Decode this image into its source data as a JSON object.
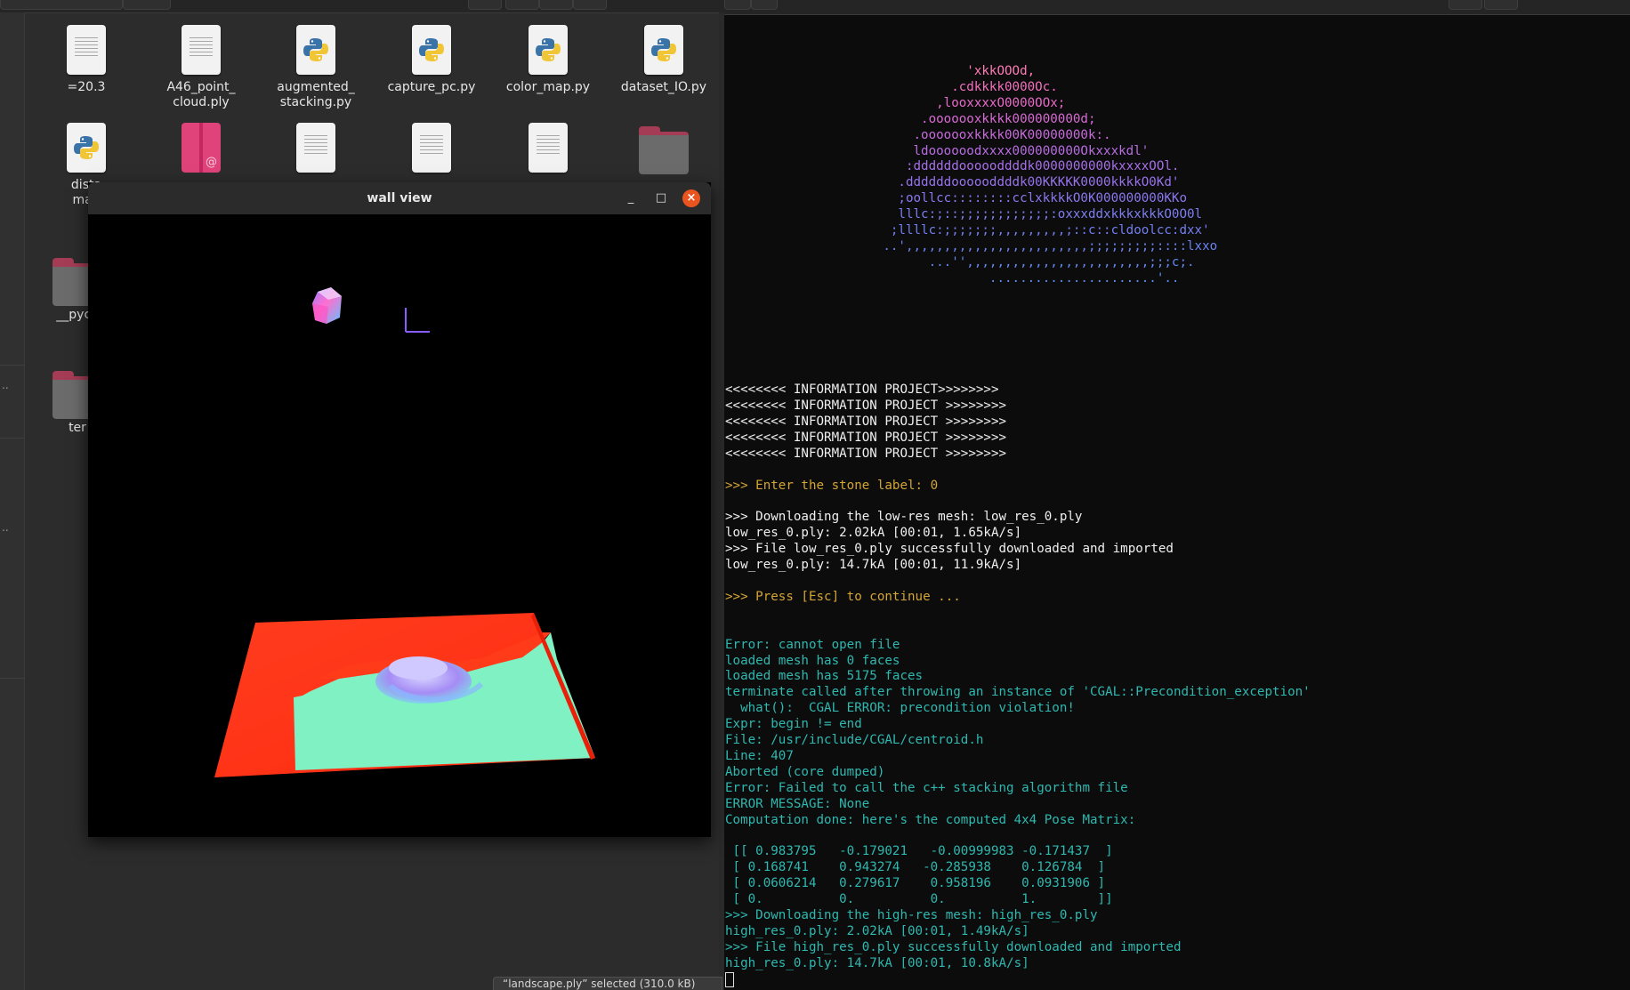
{
  "file_manager": {
    "items": [
      {
        "label": "=20.3",
        "icon": "text-file-icon"
      },
      {
        "label": "A46_point_\ncloud.ply",
        "icon": "text-file-icon"
      },
      {
        "label": "augmented_\nstacking.py",
        "icon": "python-file-icon"
      },
      {
        "label": "capture_pc.py",
        "icon": "python-file-icon"
      },
      {
        "label": "color_map.py",
        "icon": "python-file-icon"
      },
      {
        "label": "dataset_IO.py",
        "icon": "python-file-icon"
      },
      {
        "label": "dista\nmap",
        "icon": "python-file-icon"
      },
      {
        "label": "__pyca",
        "icon": "folder-icon"
      },
      {
        "label": "ter",
        "icon": "folder-icon"
      }
    ],
    "status": "“landscape.ply” selected  (310.0 kB)"
  },
  "viewer": {
    "title": "wall view",
    "minimize": "_",
    "maximize": "□",
    "close": "×"
  },
  "terminal": {
    "info_lines": [
      "<<<<<<<< INFORMATION PROJECT>>>>>>>>",
      "<<<<<<<< INFORMATION PROJECT >>>>>>>>",
      "<<<<<<<< INFORMATION PROJECT >>>>>>>>",
      "<<<<<<<< INFORMATION PROJECT >>>>>>>>",
      "<<<<<<<< INFORMATION PROJECT >>>>>>>>"
    ],
    "prompt_label": ">>> Enter the stone label: 0",
    "download_lines": [
      ">>> Downloading the low-res mesh: low_res_0.ply",
      "low_res_0.ply: 2.02kA [00:01, 1.65kA/s]",
      ">>> File low_res_0.ply successfully downloaded and imported",
      "low_res_0.ply: 14.7kA [00:01, 11.9kA/s]"
    ],
    "press_esc": ">>> Press [Esc] to continue ...",
    "error_lines": [
      "Error: cannot open file",
      "loaded mesh has 0 faces",
      "loaded mesh has 5175 faces",
      "terminate called after throwing an instance of 'CGAL::Precondition_exception'",
      "  what():  CGAL ERROR: precondition violation!",
      "Expr: begin != end",
      "File: /usr/include/CGAL/centroid.h",
      "Line: 407",
      "Aborted (core dumped)",
      "Error: Failed to call the c++ stacking algorithm file",
      "ERROR MESSAGE: None",
      "Computation done: here's the computed 4x4 Pose Matrix:"
    ],
    "matrix_lines": [
      " [[ 0.983795   -0.179021   -0.00999983 -0.171437  ]",
      " [ 0.168741    0.943274   -0.285938    0.126784  ]",
      " [ 0.0606214   0.279617    0.958196    0.0931906 ]",
      " [ 0.          0.          0.          1.        ]]"
    ],
    "final_lines": [
      ">>> Downloading the high-res mesh: high_res_0.ply",
      "high_res_0.ply: 2.02kA [00:01, 1.49kA/s]",
      ">>> File high_res_0.ply successfully downloaded and imported",
      "high_res_0.ply: 14.7kA [00:01, 10.8kA/s]"
    ],
    "ascii_art": [
      "                   'xkkOOOd,",
      "                 .cdkkkk0000Oc.",
      "               ,looxxxxO0000OOx;",
      "             .ooooooxkkkk000000000d;",
      "            .ooooooxkkkk00K00000000k:.",
      "            ldoooooodxxxx000000000Okxxxkdl'",
      "           :ddddddoooooddddk0000000000kxxxxOOl.",
      "          .ddddddoooooddddk00KKKKK0000kkkkO0Kd'",
      "          ;oollcc::::::::cclxkkkkO0K000000000KKo",
      "          lllc:;::;;;;;;;;;;;;:oxxxddxkkkxkkkO0O0l",
      "         ;llllc:;;;;;;;,,,,,,,,,;::c::cldoolcc:dxx'",
      "        ..',,,,,,,,,,,,,,,,,,,,,,,,;;;;;;;;;::::lxxo",
      "              ...'',,,,,,,,,,,,,,,,,,,,,,,,;;;c;.",
      "                      ......................'.."
    ],
    "colors": {
      "text": "#f0f0f0",
      "prompt": "#d4a534",
      "error": "#2fb8b0"
    }
  }
}
